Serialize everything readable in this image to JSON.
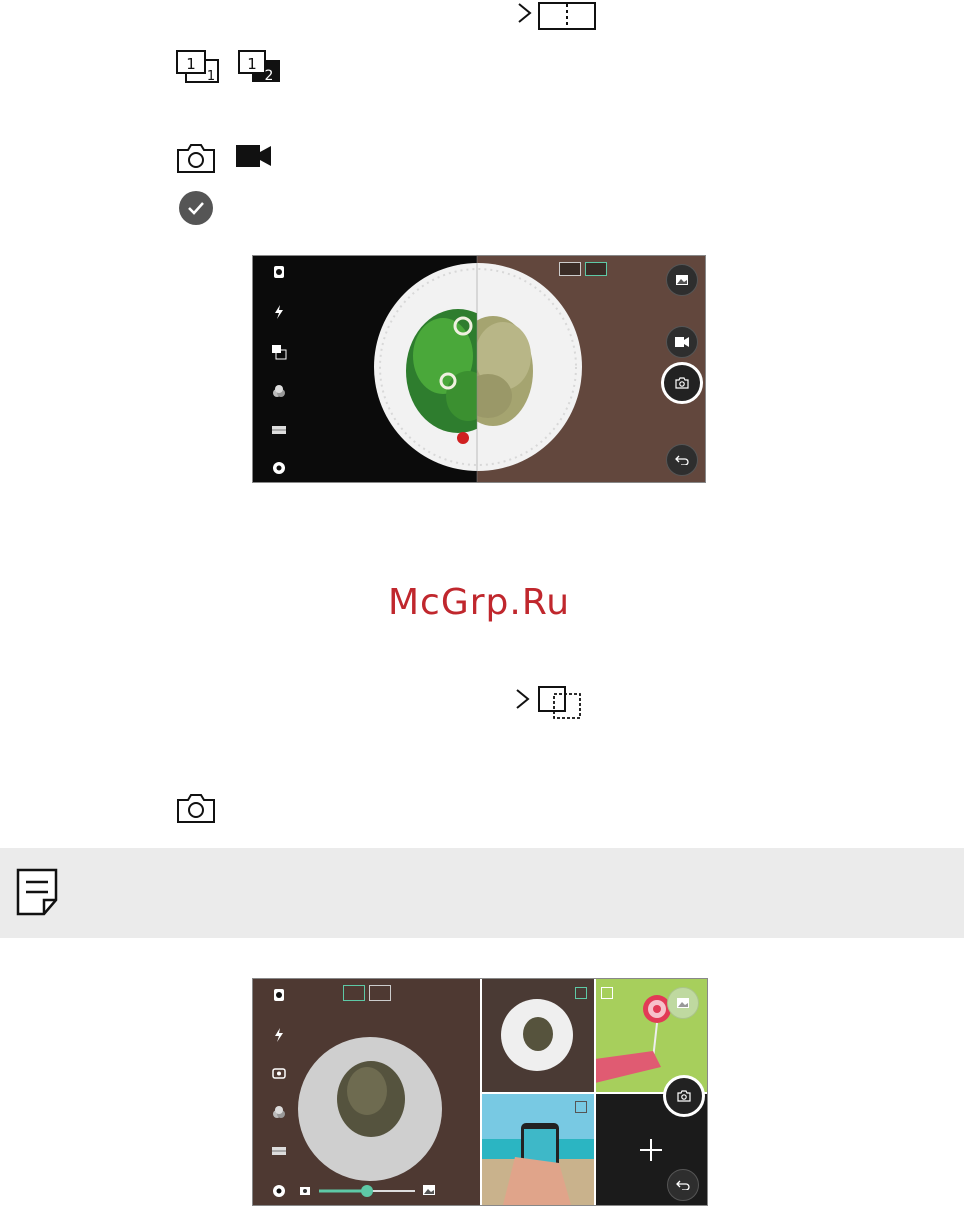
{
  "watermark": {
    "text": "McGrp.Ru"
  },
  "icons": {
    "chevron": "chevron-right-icon",
    "split_frame": "split-frame-icon",
    "one_one": "frame-1-1-icon",
    "one_two": "frame-1-2-icon",
    "camera": "camera-icon",
    "video": "video-camera-icon",
    "check": "check-circle-icon",
    "overlap_frame": "overlap-frame-icon",
    "note": "note-icon"
  },
  "screenshot1": {
    "left_rail": [
      "settings-icon",
      "grid-icon",
      "filter-icon",
      "frame-1-2-icon",
      "flash-off-icon",
      "camera-switch-icon"
    ],
    "right_rail": [
      "gallery-button",
      "video-button",
      "shutter-button",
      "back-button"
    ]
  },
  "screenshot2": {
    "zoom_level": 0.4,
    "plus_label": "+"
  },
  "colors": {
    "accent": "#5ec9a6",
    "watermark": "#c0272d",
    "note_bg": "#ebebeb"
  }
}
